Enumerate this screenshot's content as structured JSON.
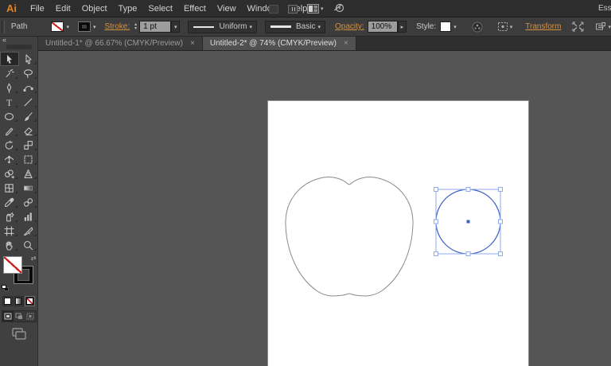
{
  "menubar": {
    "logo": "Ai",
    "items": [
      "File",
      "Edit",
      "Object",
      "Type",
      "Select",
      "Effect",
      "View",
      "Window",
      "Help"
    ],
    "right_icons": [
      "bridge-icon",
      "device-preview-icon",
      "arrange-documents-icon",
      "gpu-performance-icon"
    ],
    "workspace": "Essentials"
  },
  "controlbar": {
    "selection_type": "Path",
    "fill_swatch": "none",
    "stroke_swatch": "black",
    "stroke_label": "Stroke:",
    "stroke_weight": "1 pt",
    "width_profile": "Uniform",
    "brush": "Basic",
    "opacity_label": "Opacity:",
    "opacity": "100%",
    "style_label": "Style:",
    "transform_label": "Transform",
    "icons": [
      "recolor-artwork-icon",
      "select-similar-icon",
      "align-icon",
      "options-icon"
    ]
  },
  "tabs": [
    {
      "label": "Untitled-1* @ 66.67% (CMYK/Preview)",
      "close_glyph": "×",
      "active": false
    },
    {
      "label": "Untitled-2* @ 74% (CMYK/Preview)",
      "close_glyph": "×",
      "active": true
    }
  ],
  "toolbar": {
    "collapse_glyph": "«",
    "active_tool": "selection-tool",
    "tools": [
      {
        "name": "selection-tool",
        "active": true
      },
      {
        "name": "direct-selection-tool",
        "active": false
      },
      {
        "name": "magic-wand-tool",
        "active": false
      },
      {
        "name": "lasso-tool",
        "active": false
      },
      {
        "name": "pen-tool",
        "active": false
      },
      {
        "name": "curvature-tool",
        "active": false
      },
      {
        "name": "type-tool",
        "active": false
      },
      {
        "name": "line-segment-tool",
        "active": false
      },
      {
        "name": "ellipse-tool",
        "active": false
      },
      {
        "name": "paintbrush-tool",
        "active": false
      },
      {
        "name": "pencil-tool",
        "active": false
      },
      {
        "name": "eraser-tool",
        "active": false
      },
      {
        "name": "rotate-tool",
        "active": false
      },
      {
        "name": "scale-tool",
        "active": false
      },
      {
        "name": "width-tool",
        "active": false
      },
      {
        "name": "free-transform-tool",
        "active": false
      },
      {
        "name": "shape-builder-tool",
        "active": false
      },
      {
        "name": "perspective-grid-tool",
        "active": false
      },
      {
        "name": "mesh-tool",
        "active": false
      },
      {
        "name": "gradient-tool",
        "active": false
      },
      {
        "name": "eyedropper-tool",
        "active": false
      },
      {
        "name": "blend-tool",
        "active": false
      },
      {
        "name": "symbol-sprayer-tool",
        "active": false
      },
      {
        "name": "column-graph-tool",
        "active": false
      },
      {
        "name": "artboard-tool",
        "active": false
      },
      {
        "name": "slice-tool",
        "active": false
      },
      {
        "name": "hand-tool",
        "active": false
      },
      {
        "name": "zoom-tool",
        "active": false
      }
    ],
    "fill": "none",
    "stroke": "black",
    "draw_modes": [
      "draw-normal-mode",
      "draw-behind-mode",
      "draw-inside-mode"
    ],
    "active_draw_mode": "draw-normal-mode"
  },
  "canvas": {
    "shapes": {
      "apple_outline": {
        "selected": false
      },
      "circle": {
        "selected": true
      }
    }
  },
  "colors": {
    "accent_orange": "#d8913c",
    "apple_gray": "#8a8a8a",
    "selection_blue": "#3c60c4",
    "bbox_blue": "#8faaee",
    "handle_fill": "#ffffff",
    "canvas_gray": "#555555",
    "artboard_white": "#ffffff"
  }
}
